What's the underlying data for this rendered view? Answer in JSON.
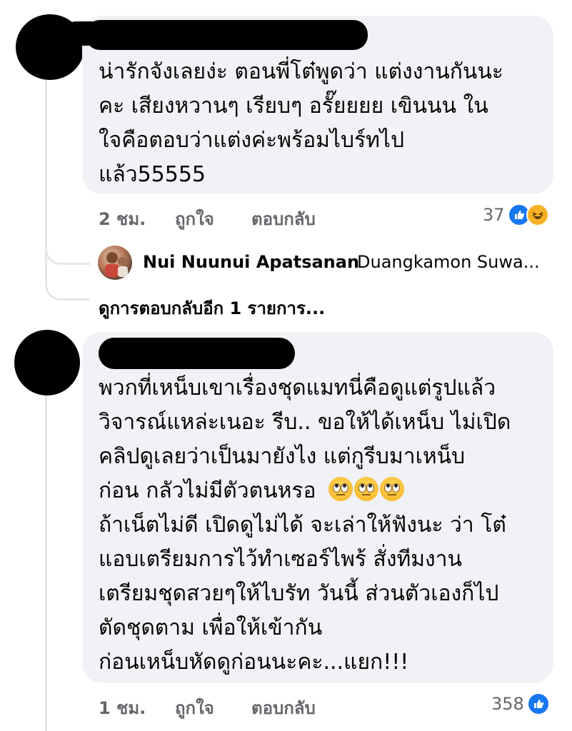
{
  "comments": [
    {
      "lines": [
        "น่ารักจังเลยง่ะ ตอนพี่โต๋พูดว่า แต่งงานกันนะ",
        "คะ เสียงหวานๆ เรียบๆ อรั๊ยยยย เขินนน ใน",
        "ใจคือตอบว่าแต่งค่ะพร้อมไบร์ทไป",
        "แล้ว55555"
      ],
      "time": "2 ชม.",
      "like_label": "ถูกใจ",
      "reply_label": "ตอบกลับ",
      "reaction_count": "37",
      "reaction_icons": [
        "like-icon",
        "haha-icon"
      ]
    },
    {
      "lines": [
        "พวกที่เหน็บเขาเรื่องชุดแมทนี่คือดูแต่รูปแล้ว",
        "วิจารณ์แหล่ะเนอะ รีบ.. ขอให้ได้เหน็บ ไม่เปิด",
        "คลิปดูเลยว่าเป็นมายังไง แต่กูรีบมาเหน็บ",
        "ก่อน กลัวไม่มีตัวตนหรอ",
        "ถ้าเน็ตไม่ดี เปิดดูไม่ได้ จะเล่าให้ฟังนะ ว่า โต๋",
        "แอบเตรียมการไว้ทำเซอร์ไพร้ สั่งทีมงาน",
        "เตรียมชุดสวยๆให้ไบรัท วันนี้ ส่วนตัวเองก็ไป",
        "ตัดชุดตาม เพื่อให้เข้ากัน",
        "ก่อนเหน็บหัดดูก่อนนะคะ...แยก!!!"
      ],
      "emoji_after_line4": "face-with-rolling-eyes",
      "time": "1 ชม.",
      "like_label": "ถูกใจ",
      "reply_label": "ตอบกลับ",
      "reaction_count": "358",
      "reaction_icons": [
        "like-icon"
      ]
    }
  ],
  "reply_preview": {
    "author": "Nui Nuunui Apatsanan",
    "snippet": "Duangkamon Suwa..."
  },
  "view_more_replies": "ดูการตอบกลับอีก 1 รายการ...",
  "colors": {
    "bubble": "#f0f2f5",
    "meta_text": "#65676b",
    "like_blue": "#1877f2",
    "haha_yellow": "#f7b125"
  }
}
